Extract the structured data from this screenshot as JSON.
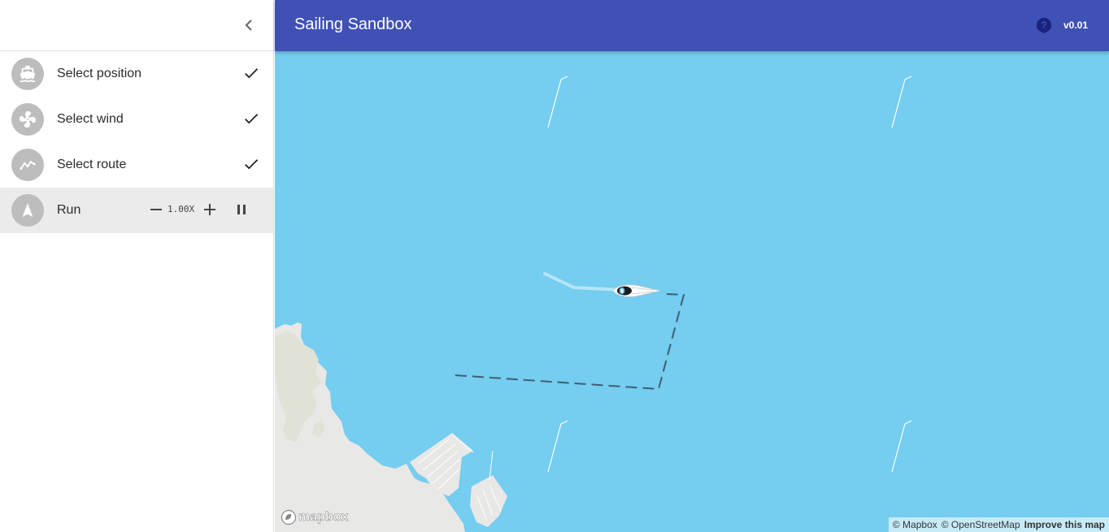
{
  "app": {
    "title": "Sailing Sandbox",
    "version": "v0.01",
    "help_icon": "help-circle-icon",
    "colors": {
      "primary": "#3f51b5",
      "water": "#75cdf0",
      "land": "#e8e8e6",
      "step_avatar": "#bdbdbd",
      "active_step_bg": "#ebebeb"
    }
  },
  "sidebar": {
    "collapse_icon": "chevron-left-icon",
    "steps": [
      {
        "label": "Select position",
        "icon": "boat-icon",
        "completed": true
      },
      {
        "label": "Select wind",
        "icon": "fan-icon",
        "completed": true
      },
      {
        "label": "Select route",
        "icon": "route-icon",
        "completed": true
      },
      {
        "label": "Run",
        "icon": "navigation-arrow-icon",
        "completed": false,
        "active": true
      }
    ],
    "run_controls": {
      "speed": "1.00X",
      "minus_icon": "minus-icon",
      "plus_icon": "plus-icon",
      "pause_icon": "pause-icon"
    }
  },
  "map": {
    "logo_text": "mapbox",
    "attribution": {
      "mapbox": "© Mapbox",
      "osm": "© OpenStreetMap",
      "improve": "Improve this map"
    },
    "wind_indicator_icon": "wind-streak-icon",
    "boat_icon": "sailboat-icon"
  }
}
